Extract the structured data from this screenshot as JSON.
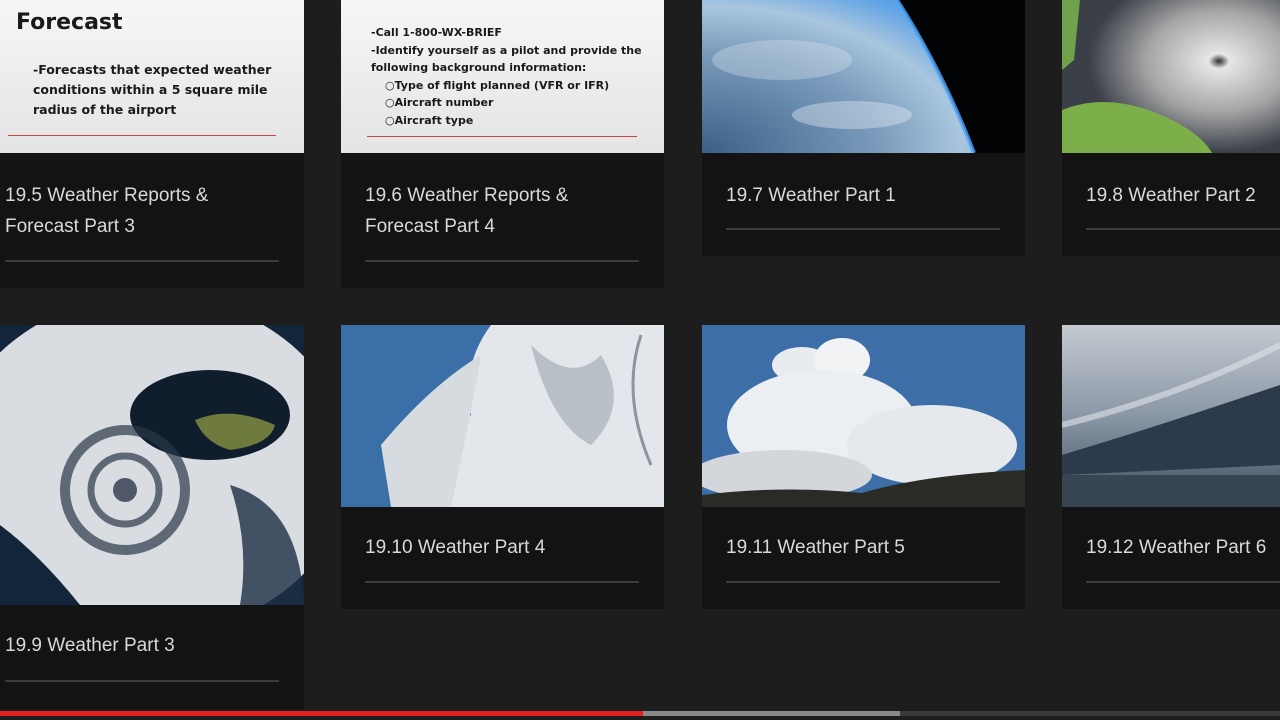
{
  "cards": [
    {
      "title": "19.5 Weather Reports & Forecast Part 3",
      "slide": {
        "heading": "Forecast",
        "lines": [
          "-Forecasts that expected weather",
          "conditions within a 5 square mile",
          "radius of the airport"
        ]
      }
    },
    {
      "title": "19.6 Weather Reports & Forecast Part 4",
      "slide": {
        "lines": [
          "-Call 1-800-WX-BRIEF",
          "-Identify yourself as a pilot and provide the",
          "following background information:",
          "○Type of flight planned (VFR or IFR)",
          "○Aircraft number",
          "○Aircraft type"
        ]
      }
    },
    {
      "title": "19.7 Weather Part 1"
    },
    {
      "title": "19.8 Weather Part 2"
    },
    {
      "title": "19.9 Weather Part 3"
    },
    {
      "title": "19.10 Weather Part 4"
    },
    {
      "title": "19.11 Weather Part 5"
    },
    {
      "title": "19.12 Weather Part 6"
    }
  ],
  "progress": {
    "played_fraction": 0.502,
    "buffered_fraction": 0.703
  },
  "colors": {
    "background": "#1d1d1e",
    "card": "#131314",
    "progress_played": "#e52020",
    "progress_buffer": "#8a8a8a"
  }
}
